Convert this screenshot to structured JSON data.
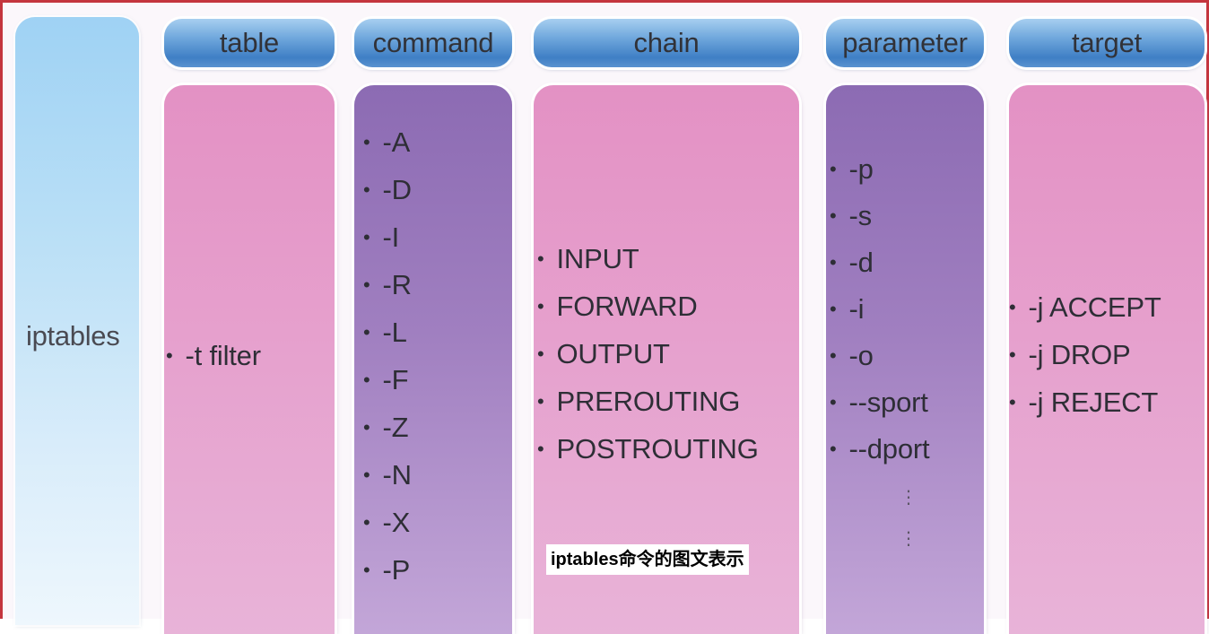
{
  "side_label": "iptables",
  "headers": {
    "table": "table",
    "command": "command",
    "chain": "chain",
    "parameter": "parameter",
    "target": "target"
  },
  "table_items": [
    "-t  filter"
  ],
  "command_items": [
    "-A",
    "-D",
    "-I",
    "-R",
    "-L",
    "-F",
    "-Z",
    "-N",
    "-X",
    "-P"
  ],
  "chain_items": [
    "INPUT",
    "FORWARD",
    "OUTPUT",
    "PREROUTING",
    "POSTROUTING"
  ],
  "parameter_items": [
    "-p",
    "-s",
    "-d",
    "-i",
    "-o",
    "--sport",
    "--dport"
  ],
  "parameter_more": "⋮",
  "target_items": [
    "-j  ACCEPT",
    "-j  DROP",
    "-j  REJECT"
  ],
  "bullet": "•",
  "caption": "iptables命令的图文表示",
  "colors": {
    "frame": "#c4353e",
    "header_blue": "#3f7fc5",
    "pink_column": "#e391c4",
    "purple_column": "#8c6bb3",
    "side_blue": "#9fd2f4"
  }
}
